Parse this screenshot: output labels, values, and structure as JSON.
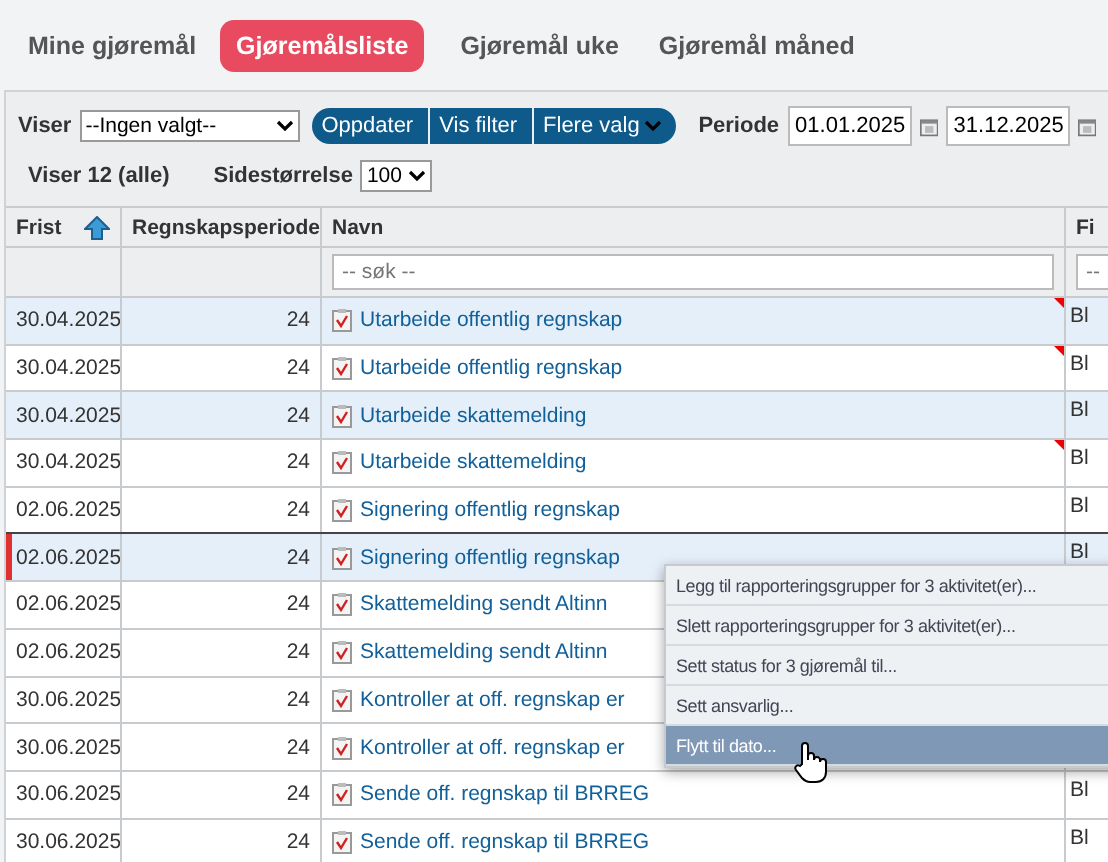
{
  "tabs": [
    {
      "label": "Mine gjøremål",
      "selected": false
    },
    {
      "label": "Gjøremålsliste",
      "selected": true
    },
    {
      "label": "Gjøremål uke",
      "selected": false
    },
    {
      "label": "Gjøremål måned",
      "selected": false
    }
  ],
  "toolbar": {
    "viser_label": "Viser",
    "viser_value": "--Ingen valgt--",
    "buttons": [
      {
        "label": "Oppdater",
        "dropdown": false
      },
      {
        "label": "Vis filter",
        "dropdown": false
      },
      {
        "label": "Flere valg",
        "dropdown": true
      }
    ],
    "periode_label": "Periode",
    "from": "01.01.2025",
    "to": "31.12.2025",
    "count": "Viser 12 (alle)",
    "pagesize_label": "Sidestørrelse",
    "pagesize": "100"
  },
  "table": {
    "columns": [
      {
        "label": "Frist",
        "sorted": true
      },
      {
        "label": "Regnskapsperiode",
        "sorted": false
      },
      {
        "label": "Navn",
        "sorted": false
      },
      {
        "label": "Fi",
        "sorted": false
      }
    ],
    "search": {
      "placeholder": "-- søk --",
      "column_4_placeholder": "--"
    },
    "rows": [
      {
        "frist": "30.04.2025",
        "periode": "24",
        "navn": "Utarbeide offentlig regnskap",
        "column_4": "Bl",
        "selected": true,
        "focused": false,
        "flagged": true
      },
      {
        "frist": "30.04.2025",
        "periode": "24",
        "navn": "Utarbeide offentlig regnskap",
        "column_4": "Bl",
        "selected": false,
        "focused": false,
        "flagged": true
      },
      {
        "frist": "30.04.2025",
        "periode": "24",
        "navn": "Utarbeide skattemelding",
        "column_4": "Bl",
        "selected": true,
        "focused": false,
        "flagged": false
      },
      {
        "frist": "30.04.2025",
        "periode": "24",
        "navn": "Utarbeide skattemelding",
        "column_4": "Bl",
        "selected": false,
        "focused": false,
        "flagged": true
      },
      {
        "frist": "02.06.2025",
        "periode": "24",
        "navn": "Signering offentlig regnskap",
        "column_4": "Bl",
        "selected": false,
        "focused": false,
        "flagged": false
      },
      {
        "frist": "02.06.2025",
        "periode": "24",
        "navn": "Signering offentlig regnskap",
        "column_4": "Bl",
        "selected": true,
        "focused": true,
        "flagged": false
      },
      {
        "frist": "02.06.2025",
        "periode": "24",
        "navn": "Skattemelding sendt Altinn",
        "selected": false,
        "focused": false,
        "flagged": false
      },
      {
        "frist": "02.06.2025",
        "periode": "24",
        "navn": "Skattemelding sendt Altinn",
        "selected": false,
        "focused": false,
        "flagged": false
      },
      {
        "frist": "30.06.2025",
        "periode": "24",
        "navn": "Kontroller at off. regnskap er",
        "selected": false,
        "focused": false,
        "flagged": false
      },
      {
        "frist": "30.06.2025",
        "periode": "24",
        "navn": "Kontroller at off. regnskap er",
        "selected": false,
        "focused": false,
        "flagged": false
      },
      {
        "frist": "30.06.2025",
        "periode": "24",
        "navn": "Sende off. regnskap til BRREG",
        "column_4": "Bl",
        "selected": false,
        "focused": false,
        "flagged": false
      },
      {
        "frist": "30.06.2025",
        "periode": "24",
        "navn": "Sende off. regnskap til BRREG",
        "column_4": "Bl",
        "selected": false,
        "focused": false,
        "flagged": false
      }
    ]
  },
  "context_menu": {
    "items": [
      {
        "label": "Legg til rapporteringsgrupper for 3 aktivitet(er)...",
        "selected": false
      },
      {
        "label": "Slett rapporteringsgrupper for 3 aktivitet(er)...",
        "selected": false
      },
      {
        "label": "Sett status for 3 gjøremål til...",
        "selected": false
      },
      {
        "label": "Sett ansvarlig...",
        "selected": false
      },
      {
        "label": "Flytt til dato...",
        "selected": true
      }
    ]
  }
}
